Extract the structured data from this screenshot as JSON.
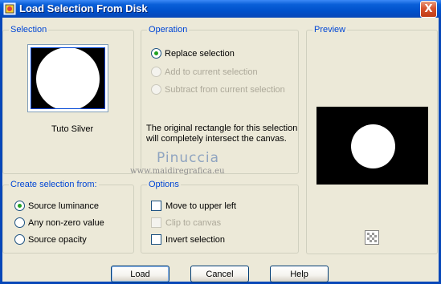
{
  "window": {
    "title": "Load Selection From Disk",
    "close_label": "X"
  },
  "selection": {
    "group_label": "Selection",
    "file_name": "Tuto Silver"
  },
  "operation": {
    "group_label": "Operation",
    "options": [
      {
        "label": "Replace selection",
        "checked": true,
        "enabled": true
      },
      {
        "label": "Add to current selection",
        "checked": false,
        "enabled": false
      },
      {
        "label": "Subtract from current selection",
        "checked": false,
        "enabled": false
      }
    ],
    "info_line1": "The original rectangle for this selection",
    "info_line2": "will completely intersect the canvas."
  },
  "preview": {
    "group_label": "Preview",
    "zoom_icon": "checkerboard-icon"
  },
  "create_from": {
    "group_label": "Create selection from:",
    "options": [
      {
        "label": "Source luminance",
        "checked": true
      },
      {
        "label": "Any non-zero value",
        "checked": false
      },
      {
        "label": "Source opacity",
        "checked": false
      }
    ]
  },
  "options": {
    "group_label": "Options",
    "items": [
      {
        "label": "Move to upper left",
        "checked": false,
        "enabled": true
      },
      {
        "label": "Clip to canvas",
        "checked": false,
        "enabled": false
      },
      {
        "label": "Invert selection",
        "checked": false,
        "enabled": true
      }
    ]
  },
  "watermark": {
    "name": "Pinuccia",
    "url": "www.maidiregrafica.eu"
  },
  "buttons": {
    "load": "Load",
    "cancel": "Cancel",
    "help": "Help"
  },
  "colors": {
    "title_bar": "#0052cc",
    "group_label": "#0046d5",
    "dialog_bg": "#ece9d8",
    "radio_checked": "#21a121"
  }
}
